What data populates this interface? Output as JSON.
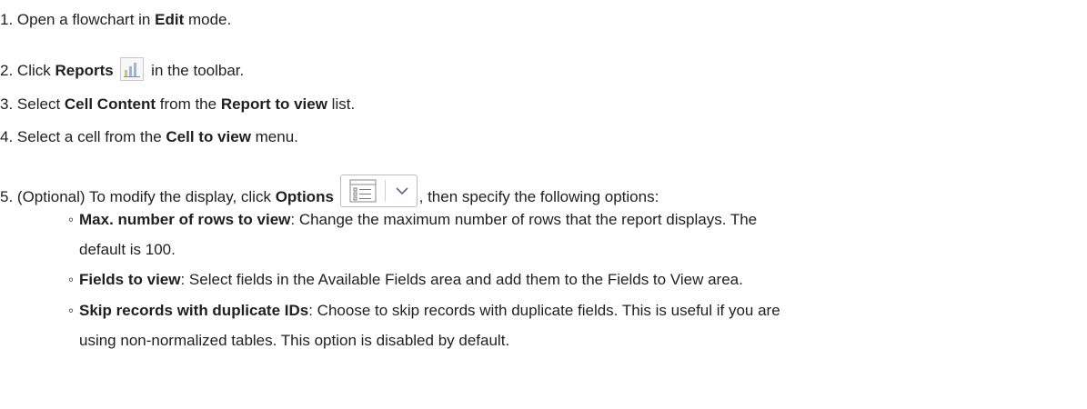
{
  "steps": [
    {
      "num": "1.",
      "t1": "Open a flowchart in ",
      "b1": "Edit",
      "t2": " mode."
    },
    {
      "num": "2.",
      "t1": "Click ",
      "b1": "Reports",
      "t2": " in the toolbar.",
      "icon": "reports-bar-chart-icon"
    },
    {
      "num": "3.",
      "t1": "Select ",
      "b1": "Cell Content",
      "t2": " from the ",
      "b2": "Report to view",
      "t3": " list."
    },
    {
      "num": "4.",
      "t1": "Select a cell from the ",
      "b1": "Cell to view",
      "t2": " menu."
    },
    {
      "num": "5.",
      "t1": "(Optional) To modify the display, click ",
      "b1": "Options",
      "t2": ", then specify the following options:",
      "icon": "options-list-dropdown-icon"
    }
  ],
  "options": [
    {
      "bullet": "◦",
      "term": "Max. number of rows to view",
      "desc1": ": Change the maximum number of rows that the report displays. The",
      "desc2": "default is 100."
    },
    {
      "bullet": "◦",
      "term": "Fields to view",
      "desc1": ": Select fields in the Available Fields area and add them to the Fields to View area."
    },
    {
      "bullet": "◦",
      "term": "Skip records with duplicate IDs",
      "desc1": ": Choose to skip records with duplicate fields. This is useful if you are",
      "desc2": "using non-normalized tables. This option is disabled by default."
    }
  ]
}
